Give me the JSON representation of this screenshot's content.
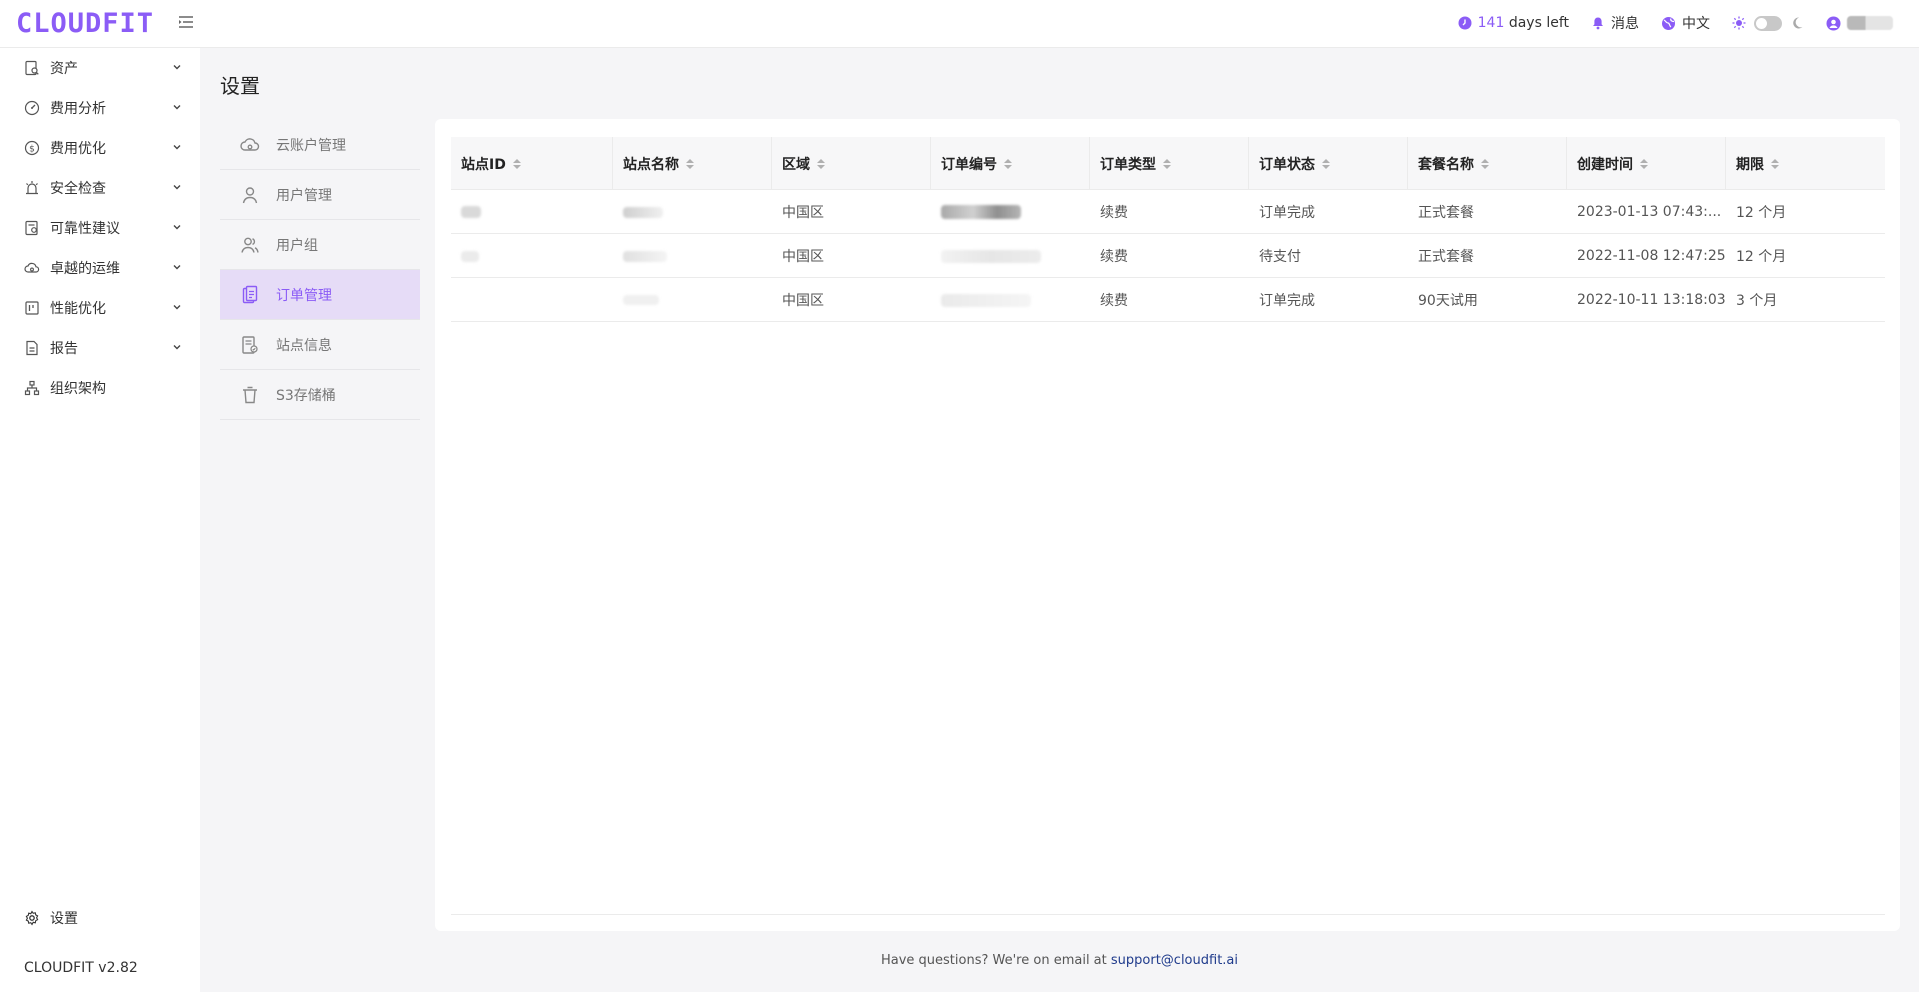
{
  "app": {
    "logo": "CLOUDFIT",
    "version": "CLOUDFIT v2.82",
    "accent_color": "#8b5cf6"
  },
  "topbar": {
    "trial_days": "141",
    "trial_suffix": "days left",
    "messages_label": "消息",
    "language_label": "中文",
    "icons": [
      "clock-icon",
      "bell-icon",
      "globe-icon",
      "sun-icon",
      "theme-toggle",
      "moon-icon",
      "user-icon"
    ]
  },
  "sidebar": {
    "items": [
      {
        "label": "资产",
        "icon": "asset-search-icon",
        "expandable": true
      },
      {
        "label": "费用分析",
        "icon": "gauge-icon",
        "expandable": true
      },
      {
        "label": "费用优化",
        "icon": "dollar-circle-icon",
        "expandable": true
      },
      {
        "label": "安全检查",
        "icon": "alarm-icon",
        "expandable": true
      },
      {
        "label": "可靠性建议",
        "icon": "doc-search-icon",
        "expandable": true
      },
      {
        "label": "卓越的运维",
        "icon": "cloud-gear-icon",
        "expandable": true
      },
      {
        "label": "性能优化",
        "icon": "board-icon",
        "expandable": true
      },
      {
        "label": "报告",
        "icon": "report-icon",
        "expandable": true
      },
      {
        "label": "组织架构",
        "icon": "org-chart-icon",
        "expandable": false
      }
    ],
    "settings_label": "设置"
  },
  "page": {
    "title": "设置"
  },
  "settings_nav": {
    "items": [
      {
        "label": "云账户管理",
        "icon": "cloud-account-icon",
        "active": false
      },
      {
        "label": "用户管理",
        "icon": "user-icon",
        "active": false
      },
      {
        "label": "用户组",
        "icon": "user-group-icon",
        "active": false
      },
      {
        "label": "订单管理",
        "icon": "clipboard-icon",
        "active": true
      },
      {
        "label": "站点信息",
        "icon": "site-info-icon",
        "active": false
      },
      {
        "label": "S3存储桶",
        "icon": "bucket-icon",
        "active": false
      }
    ]
  },
  "orders_table": {
    "columns": [
      "站点ID",
      "站点名称",
      "区域",
      "订单编号",
      "订单类型",
      "订单状态",
      "套餐名称",
      "创建时间",
      "期限"
    ],
    "rows": [
      {
        "region": "中国区",
        "type": "续费",
        "status": "订单完成",
        "plan": "正式套餐",
        "created": "2023-01-13 07:43:...",
        "term": "12 个月"
      },
      {
        "region": "中国区",
        "type": "续费",
        "status": "待支付",
        "plan": "正式套餐",
        "created": "2022-11-08 12:47:25",
        "term": "12 个月"
      },
      {
        "region": "中国区",
        "type": "续费",
        "status": "订单完成",
        "plan": "90天试用",
        "created": "2022-10-11 13:18:03",
        "term": "3 个月"
      }
    ]
  },
  "footer": {
    "text": "Have questions? We're on email at",
    "email": "support@cloudfit.ai"
  }
}
